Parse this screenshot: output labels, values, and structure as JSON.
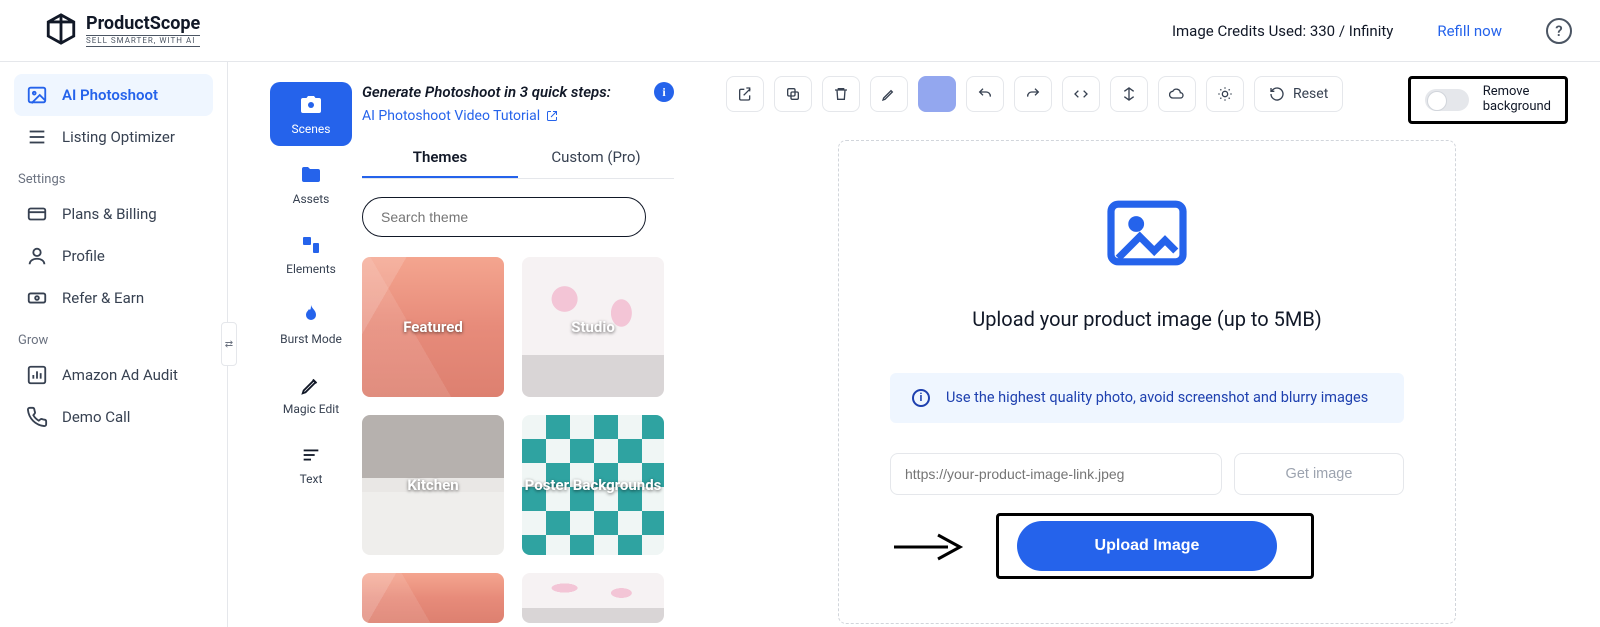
{
  "brand": {
    "name": "ProductScope",
    "tagline": "SELL SMARTER, WITH AI"
  },
  "header": {
    "credits": "Image Credits Used: 330 / Infinity",
    "refill": "Refill now",
    "help": "?"
  },
  "sidebar": {
    "items": [
      {
        "label": "AI Photoshoot"
      },
      {
        "label": "Listing Optimizer"
      }
    ],
    "settings_label": "Settings",
    "settings": [
      {
        "label": "Plans & Billing"
      },
      {
        "label": "Profile"
      },
      {
        "label": "Refer & Earn"
      }
    ],
    "grow_label": "Grow",
    "grow": [
      {
        "label": "Amazon Ad Audit"
      },
      {
        "label": "Demo Call"
      }
    ]
  },
  "vtabs": [
    {
      "label": "Scenes"
    },
    {
      "label": "Assets"
    },
    {
      "label": "Elements"
    },
    {
      "label": "Burst Mode"
    },
    {
      "label": "Magic Edit"
    },
    {
      "label": "Text"
    }
  ],
  "panel": {
    "title": "Generate Photoshoot in 3 quick steps:",
    "tutorial": "AI Photoshoot Video Tutorial",
    "tabs": {
      "themes": "Themes",
      "custom": "Custom (Pro)"
    },
    "search_placeholder": "Search theme",
    "cards": [
      {
        "label": "Featured"
      },
      {
        "label": "Studio"
      },
      {
        "label": "Kitchen"
      },
      {
        "label": "Poster Backgrounds"
      }
    ]
  },
  "toolbar": {
    "reset": "Reset",
    "remove_bg_line1": "Remove",
    "remove_bg_line2": "background"
  },
  "upload": {
    "title": "Upload your product image (up to 5MB)",
    "note": "Use the highest quality photo, avoid screenshot and blurry images",
    "url_placeholder": "https://your-product-image-link.jpeg",
    "get_image": "Get image",
    "button": "Upload Image"
  }
}
